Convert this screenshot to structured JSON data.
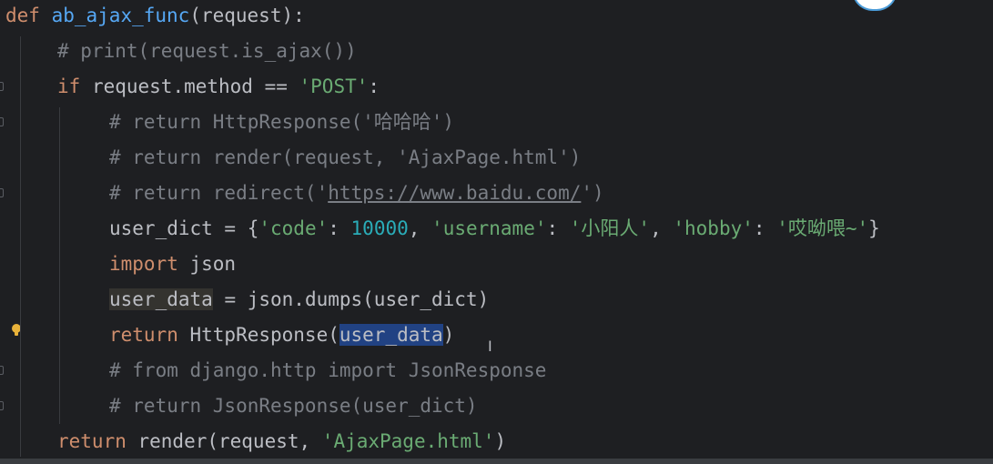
{
  "editor": {
    "lines": [
      {
        "indent": 0,
        "tokens": [
          {
            "t": "def",
            "c": "kw"
          },
          {
            "t": " ",
            "c": ""
          },
          {
            "t": "ab_ajax_func",
            "c": "fn"
          },
          {
            "t": "(request):",
            "c": ""
          }
        ]
      },
      {
        "indent": 1,
        "tokens": [
          {
            "t": "# print(request.is_ajax())",
            "c": "cm"
          }
        ]
      },
      {
        "indent": 1,
        "tokens": [
          {
            "t": "if",
            "c": "kw"
          },
          {
            "t": " request.method == ",
            "c": ""
          },
          {
            "t": "'POST'",
            "c": "str"
          },
          {
            "t": ":",
            "c": ""
          }
        ]
      },
      {
        "indent": 2,
        "tokens": [
          {
            "t": "# return HttpResponse('哈哈哈')",
            "c": "cm"
          }
        ]
      },
      {
        "indent": 2,
        "tokens": [
          {
            "t": "# return render(request, 'AjaxPage.html')",
            "c": "cm"
          }
        ]
      },
      {
        "indent": 2,
        "tokens": [
          {
            "t": "# return redirect('",
            "c": "cm"
          },
          {
            "t": "https://www.baidu.com/",
            "c": "cm link"
          },
          {
            "t": "')",
            "c": "cm"
          }
        ]
      },
      {
        "indent": 2,
        "tokens": [
          {
            "t": "user_dict = {",
            "c": ""
          },
          {
            "t": "'code'",
            "c": "str"
          },
          {
            "t": ": ",
            "c": ""
          },
          {
            "t": "10000",
            "c": "num"
          },
          {
            "t": ", ",
            "c": ""
          },
          {
            "t": "'username'",
            "c": "str"
          },
          {
            "t": ": ",
            "c": ""
          },
          {
            "t": "'小阳人'",
            "c": "str"
          },
          {
            "t": ", ",
            "c": ""
          },
          {
            "t": "'hobby'",
            "c": "str"
          },
          {
            "t": ": ",
            "c": ""
          },
          {
            "t": "'哎呦喂~'",
            "c": "str"
          },
          {
            "t": "}",
            "c": ""
          }
        ]
      },
      {
        "indent": 2,
        "tokens": [
          {
            "t": "import",
            "c": "kw"
          },
          {
            "t": " json",
            "c": ""
          }
        ]
      },
      {
        "indent": 2,
        "tokens": [
          {
            "t": "user_data",
            "c": "usage-hl"
          },
          {
            "t": " = json.dumps(user_dict)",
            "c": ""
          }
        ]
      },
      {
        "indent": 2,
        "tokens": [
          {
            "t": "return",
            "c": "kw"
          },
          {
            "t": " HttpResponse(",
            "c": ""
          },
          {
            "t": "user_data",
            "c": "selected"
          },
          {
            "t": ")",
            "c": ""
          }
        ]
      },
      {
        "indent": 2,
        "tokens": [
          {
            "t": "# from django.http import JsonResponse",
            "c": "cm"
          }
        ]
      },
      {
        "indent": 2,
        "tokens": [
          {
            "t": "# return JsonResponse(user_dict)",
            "c": "cm"
          }
        ]
      },
      {
        "indent": 1,
        "tokens": [
          {
            "t": "return",
            "c": "kw"
          },
          {
            "t": " render(request, ",
            "c": ""
          },
          {
            "t": "'AjaxPage.html'",
            "c": "str"
          },
          {
            "t": ")",
            "c": ""
          }
        ]
      }
    ],
    "cursor_glyph": "I"
  },
  "colors": {
    "background": "#1e1f22",
    "keyword": "#cf8e6d",
    "function": "#56a8f5",
    "comment": "#7a7e85",
    "string": "#6aab73",
    "number": "#2aacb8",
    "selection": "#214283"
  }
}
